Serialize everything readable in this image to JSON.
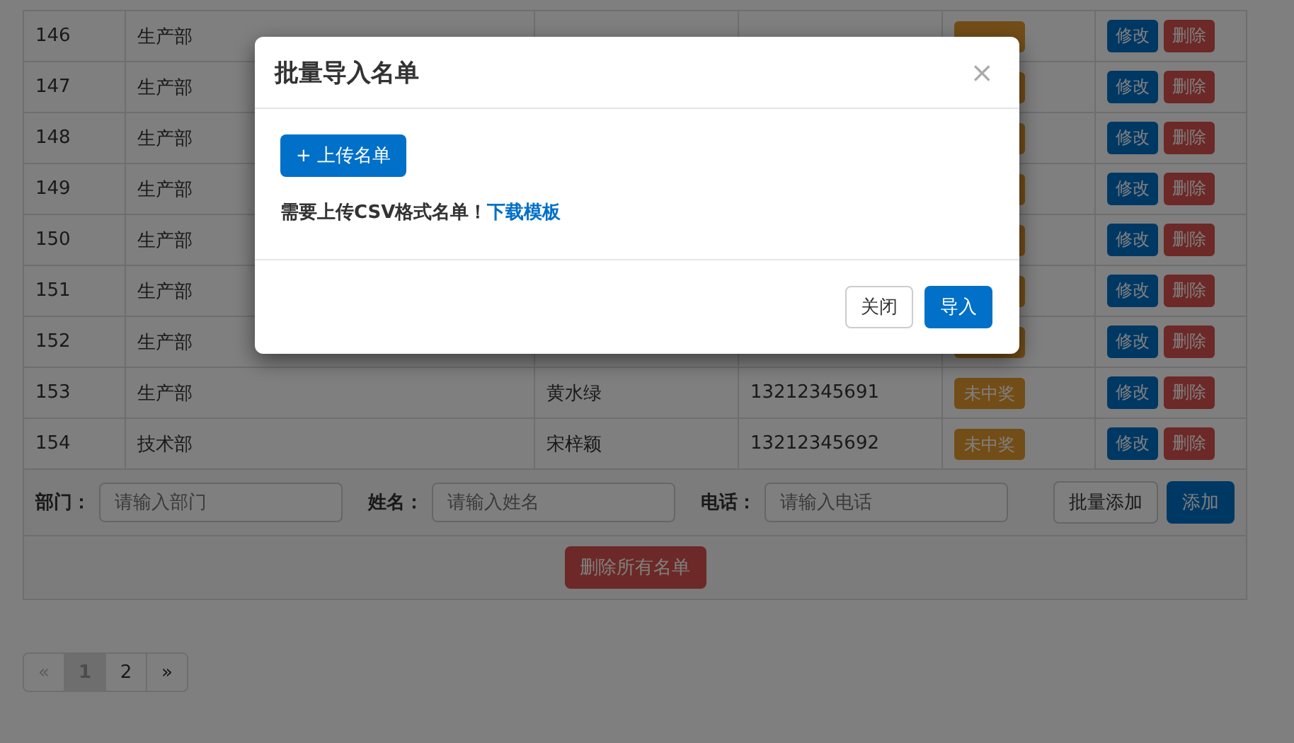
{
  "table": {
    "rows": [
      {
        "id": "146",
        "department": "生产部",
        "badge": true,
        "actions": [
          "修改",
          "删除"
        ]
      },
      {
        "id": "147",
        "department": "生产部",
        "badge": true,
        "actions": [
          "修改",
          "删除"
        ]
      },
      {
        "id": "148",
        "department": "生产部",
        "badge": true,
        "actions": [
          "修改",
          "删除"
        ]
      },
      {
        "id": "149",
        "department": "生产部",
        "badge": true,
        "actions": [
          "修改",
          "删除"
        ]
      },
      {
        "id": "150",
        "department": "生产部",
        "badge": true,
        "actions": [
          "修改",
          "删除"
        ]
      },
      {
        "id": "151",
        "department": "生产部",
        "badge": true,
        "actions": [
          "修改",
          "删除"
        ]
      },
      {
        "id": "152",
        "department": "生产部",
        "badge": true,
        "actions": [
          "修改",
          "删除"
        ]
      },
      {
        "id": "153",
        "department": "生产部",
        "name": "黄水绿",
        "phone": "13212345691",
        "status": "未中奖",
        "badge": true,
        "actions": [
          "修改",
          "删除"
        ]
      },
      {
        "id": "154",
        "department": "技术部",
        "name": "宋梓颖",
        "phone": "13212345692",
        "status": "未中奖",
        "badge": true,
        "actions": [
          "修改",
          "删除"
        ]
      }
    ]
  },
  "add_form": {
    "fields": [
      {
        "label": "部门：",
        "placeholder": "请输入部门"
      },
      {
        "label": "姓名：",
        "placeholder": "请输入姓名"
      },
      {
        "label": "电话：",
        "placeholder": "请输入电话"
      }
    ],
    "batch_button": "批量添加",
    "add_button": "添加"
  },
  "delete_all_button": "删除所有名单",
  "pagination": [
    {
      "label": "«",
      "disabled": true,
      "selected": false
    },
    {
      "label": "1",
      "disabled": false,
      "selected": true
    },
    {
      "label": "2",
      "disabled": false,
      "selected": false
    },
    {
      "label": "»",
      "disabled": false,
      "selected": false
    }
  ],
  "modal": {
    "title": "批量导入名单",
    "close": "×",
    "upload_button": "+ 上传名单",
    "hint": "需要上传CSV格式名单！",
    "hint_link": "下载模板",
    "cancel_button": "关闭",
    "import_button": "导入"
  }
}
